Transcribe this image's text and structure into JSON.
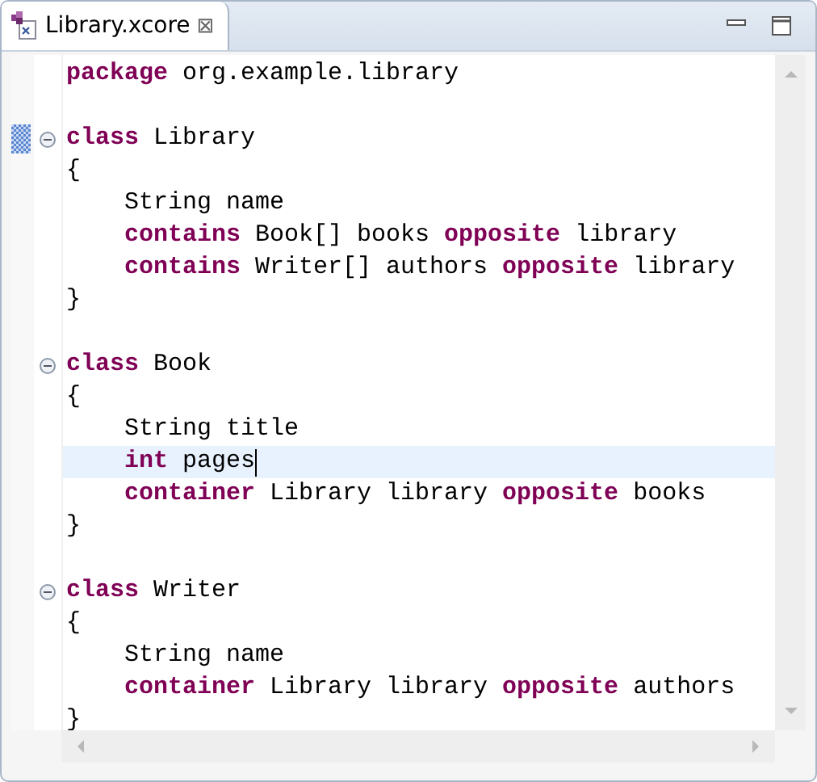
{
  "tab": {
    "title": "Library.xcore",
    "close": "⊠",
    "selected": true
  },
  "lines": [
    {
      "current": false,
      "tokens": [
        {
          "kind": "keyword",
          "text": "package"
        },
        {
          "kind": "plain",
          "text": " org.example.library"
        }
      ]
    },
    {
      "current": false
    },
    {
      "current": false,
      "fold": true,
      "marker": true,
      "tokens": [
        {
          "kind": "keyword",
          "text": "class"
        },
        {
          "kind": "plain",
          "text": " Library"
        }
      ]
    },
    {
      "current": false,
      "tokens": [
        {
          "kind": "plain",
          "text": "{"
        }
      ],
      "children": [
        {
          "current": false,
          "tokens": [
            {
              "kind": "plain",
              "text": "String name"
            }
          ]
        },
        {
          "current": false,
          "tokens": [
            {
              "kind": "keyword",
              "text": "contains"
            },
            {
              "kind": "plain",
              "text": " Book[] books "
            },
            {
              "kind": "keyword",
              "text": "opposite"
            },
            {
              "kind": "plain",
              "text": " library"
            }
          ]
        },
        {
          "current": false,
          "tokens": [
            {
              "kind": "keyword",
              "text": "contains"
            },
            {
              "kind": "plain",
              "text": " Writer[] authors "
            },
            {
              "kind": "keyword",
              "text": "opposite"
            },
            {
              "kind": "plain",
              "text": " library"
            }
          ]
        }
      ]
    },
    {
      "current": false,
      "tokens": [
        {
          "kind": "plain",
          "text": "}"
        }
      ]
    },
    {
      "current": false
    },
    {
      "current": false,
      "fold": true,
      "tokens": [
        {
          "kind": "keyword",
          "text": "class"
        },
        {
          "kind": "plain",
          "text": " Book"
        }
      ]
    },
    {
      "current": false,
      "tokens": [
        {
          "kind": "plain",
          "text": "{"
        }
      ],
      "children": [
        {
          "current": false,
          "tokens": [
            {
              "kind": "plain",
              "text": "String title"
            }
          ]
        },
        {
          "current": true,
          "tokens": [
            {
              "kind": "keyword",
              "text": "int"
            },
            {
              "kind": "plain",
              "text": " pages"
            }
          ]
        },
        {
          "current": false,
          "tokens": [
            {
              "kind": "keyword",
              "text": "container"
            },
            {
              "kind": "plain",
              "text": " Library library "
            },
            {
              "kind": "keyword",
              "text": "opposite"
            },
            {
              "kind": "plain",
              "text": " books"
            }
          ]
        }
      ]
    },
    {
      "current": false,
      "tokens": [
        {
          "kind": "plain",
          "text": "}"
        }
      ]
    },
    {
      "current": false
    },
    {
      "current": false,
      "fold": true,
      "tokens": [
        {
          "kind": "keyword",
          "text": "class"
        },
        {
          "kind": "plain",
          "text": " Writer"
        }
      ]
    },
    {
      "current": false,
      "tokens": [
        {
          "kind": "plain",
          "text": "{"
        }
      ],
      "children": [
        {
          "current": false,
          "tokens": [
            {
              "kind": "plain",
              "text": "String name"
            }
          ]
        },
        {
          "current": false,
          "tokens": [
            {
              "kind": "keyword",
              "text": "container"
            },
            {
              "kind": "plain",
              "text": " Library library "
            },
            {
              "kind": "keyword",
              "text": "opposite"
            },
            {
              "kind": "plain",
              "text": " authors"
            }
          ]
        }
      ]
    },
    {
      "current": false,
      "tokens": [
        {
          "kind": "plain",
          "text": "}"
        }
      ]
    }
  ]
}
